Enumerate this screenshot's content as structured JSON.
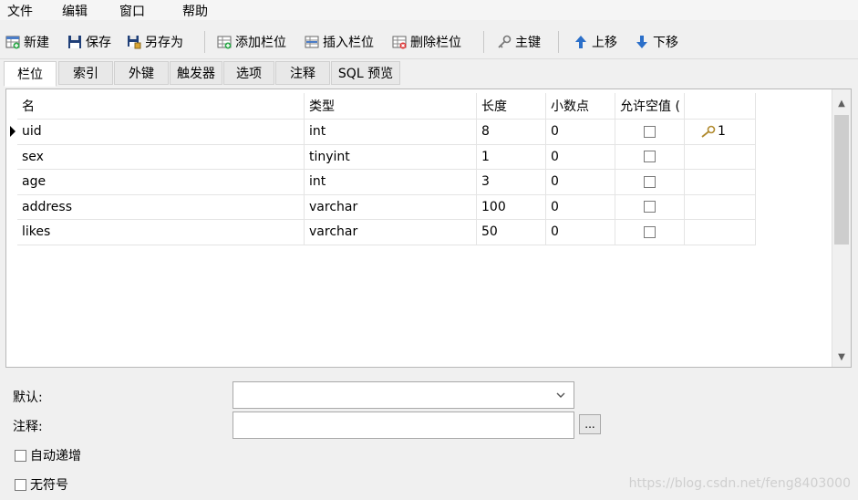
{
  "menubar": {
    "items": [
      "文件",
      "编辑",
      "窗口",
      "帮助"
    ]
  },
  "toolbar": {
    "new_label": "新建",
    "save_label": "保存",
    "save_as_label": "另存为",
    "add_column_label": "添加栏位",
    "insert_column_label": "插入栏位",
    "delete_column_label": "删除栏位",
    "primary_key_label": "主键",
    "move_up_label": "上移",
    "move_down_label": "下移"
  },
  "tabs": [
    "栏位",
    "索引",
    "外键",
    "触发器",
    "选项",
    "注释",
    "SQL 预览"
  ],
  "active_tab": "栏位",
  "grid": {
    "columns": [
      "名",
      "类型",
      "长度",
      "小数点",
      "允许空值 (",
      ""
    ],
    "rows": [
      {
        "name": "uid",
        "type": "int",
        "length": "8",
        "decimals": "0",
        "nullable": false,
        "key": "1",
        "current": true
      },
      {
        "name": "sex",
        "type": "tinyint",
        "length": "1",
        "decimals": "0",
        "nullable": false,
        "key": "",
        "current": false
      },
      {
        "name": "age",
        "type": "int",
        "length": "3",
        "decimals": "0",
        "nullable": false,
        "key": "",
        "current": false
      },
      {
        "name": "address",
        "type": "varchar",
        "length": "100",
        "decimals": "0",
        "nullable": false,
        "key": "",
        "current": false
      },
      {
        "name": "likes",
        "type": "varchar",
        "length": "50",
        "decimals": "0",
        "nullable": false,
        "key": "",
        "current": false
      }
    ]
  },
  "properties": {
    "default_label": "默认:",
    "default_value": "",
    "comment_label": "注释:",
    "comment_value": "",
    "ellipsis_label": "...",
    "auto_increment_label": "自动递增",
    "auto_increment_checked": false,
    "unsigned_label": "无符号",
    "unsigned_checked": false
  },
  "watermark": "https://blog.csdn.net/feng8403000",
  "colors": {
    "accent_blue": "#2b6fc9",
    "key_gold": "#b08a2e"
  }
}
